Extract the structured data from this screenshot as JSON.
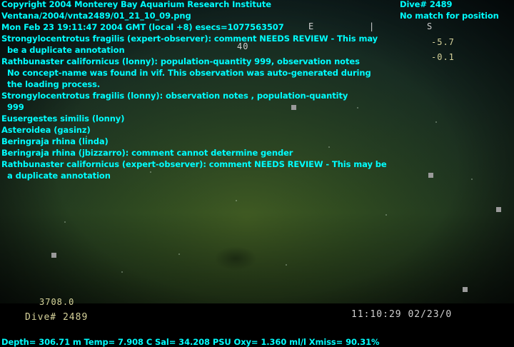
{
  "header": {
    "copyright": "Copyright 2004 Monterey Bay Aquarium Research Institute",
    "filepath": "Ventana/2004/vnta2489/01_21_10_09.png",
    "timestamp": "Mon Feb 23 19:11:47 2004 GMT (local +8)  esecs=1077563507",
    "dive": "Dive# 2489",
    "position_status": "No match for position"
  },
  "annotations": [
    "Strongylocentrotus fragilis (expert-observer): comment NEEDS REVIEW - This may",
    "  be a duplicate annotation",
    "Rathbunaster californicus (lonny): population-quantity 999, observation notes",
    "  No concept-name was found in vif. This observation was auto-generated during",
    "  the loading process.",
    "Strongylocentrotus fragilis (lonny): observation notes , population-quantity",
    "  999",
    "Eusergestes similis (lonny)",
    "Asteroidea (gasinz)",
    "Beringraja rhina (linda)",
    "Beringraja rhina (jbizzarro): comment cannot determine gender",
    "Rathbunaster californicus (expert-observer): comment NEEDS REVIEW - This may be",
    "  a duplicate annotation"
  ],
  "camera_overlay": {
    "compass_e": "E",
    "compass_s": "S",
    "heading_40": "40",
    "pitch": "-5.7",
    "roll": "-0.1",
    "depth_readout": "3708.0",
    "dive_burn": "Dive# 2489",
    "clock": "11:10:29 02/23/0"
  },
  "footer": {
    "sensors": "Depth= 306.71 m  Temp= 7.908 C  Sal= 34.208 PSU  Oxy= 1.360 ml/l  Xmiss= 90.31%"
  }
}
